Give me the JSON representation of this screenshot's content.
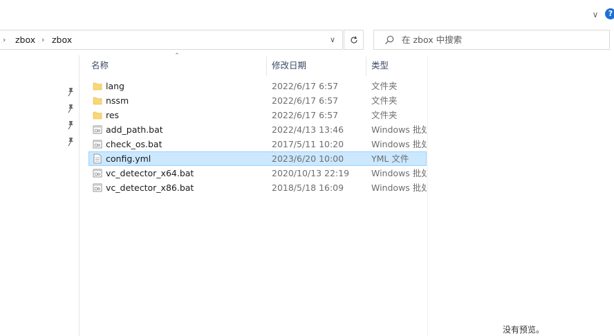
{
  "ribbon": {
    "collapse_icon": "chevron-down-icon",
    "help_label": "?"
  },
  "address_bar": {
    "crumbs": [
      "zbox",
      "zbox"
    ],
    "dropdown_icon": "chevron-down-icon",
    "refresh_icon": "refresh-icon"
  },
  "search": {
    "placeholder": "在 zbox 中搜索"
  },
  "columns": {
    "name": "名称",
    "date": "修改日期",
    "type": "类型"
  },
  "files": [
    {
      "name": "lang",
      "date": "2022/6/17 6:57",
      "type": "文件夹",
      "icon": "folder-icon",
      "selected": false
    },
    {
      "name": "nssm",
      "date": "2022/6/17 6:57",
      "type": "文件夹",
      "icon": "folder-icon",
      "selected": false
    },
    {
      "name": "res",
      "date": "2022/6/17 6:57",
      "type": "文件夹",
      "icon": "folder-icon",
      "selected": false
    },
    {
      "name": "add_path.bat",
      "date": "2022/4/13 13:46",
      "type": "Windows 批处理文件",
      "icon": "bat-file-icon",
      "selected": false
    },
    {
      "name": "check_os.bat",
      "date": "2017/5/11 10:20",
      "type": "Windows 批处理文件",
      "icon": "bat-file-icon",
      "selected": false
    },
    {
      "name": "config.yml",
      "date": "2023/6/20 10:00",
      "type": "YML 文件",
      "icon": "text-file-icon",
      "selected": true
    },
    {
      "name": "vc_detector_x64.bat",
      "date": "2020/10/13 22:19",
      "type": "Windows 批处理文件",
      "icon": "bat-file-icon",
      "selected": false
    },
    {
      "name": "vc_detector_x86.bat",
      "date": "2018/5/18 16:09",
      "type": "Windows 批处理文件",
      "icon": "bat-file-icon",
      "selected": false
    }
  ],
  "preview": {
    "empty_text": "没有预览。"
  },
  "colors": {
    "selection_bg": "#cce8ff",
    "selection_border": "#99d1ff",
    "folder": "#f8d775",
    "accent": "#1c6fd6"
  }
}
